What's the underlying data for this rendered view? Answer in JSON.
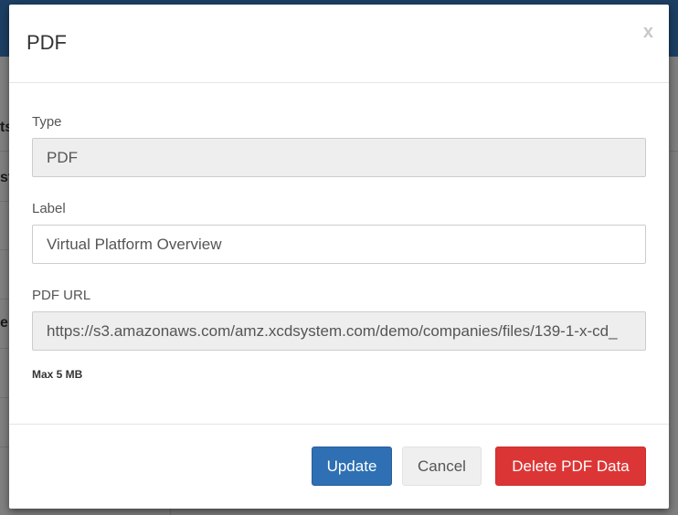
{
  "background": {
    "fragments": [
      "ts",
      "st",
      "e"
    ]
  },
  "modal": {
    "title": "PDF",
    "close_label": "x",
    "fields": {
      "type": {
        "label": "Type",
        "value": "PDF"
      },
      "label": {
        "label": "Label",
        "value": "Virtual Platform Overview"
      },
      "pdf_url": {
        "label": "PDF URL",
        "value": "https://s3.amazonaws.com/amz.xcdsystem.com/demo/companies/files/139-1-x-cd_"
      }
    },
    "help_text": "Max 5 MB",
    "buttons": {
      "update": "Update",
      "cancel": "Cancel",
      "delete": "Delete PDF Data"
    }
  },
  "colors": {
    "primary": "#2e70b3",
    "danger": "#dc3535",
    "default": "#efefef"
  }
}
